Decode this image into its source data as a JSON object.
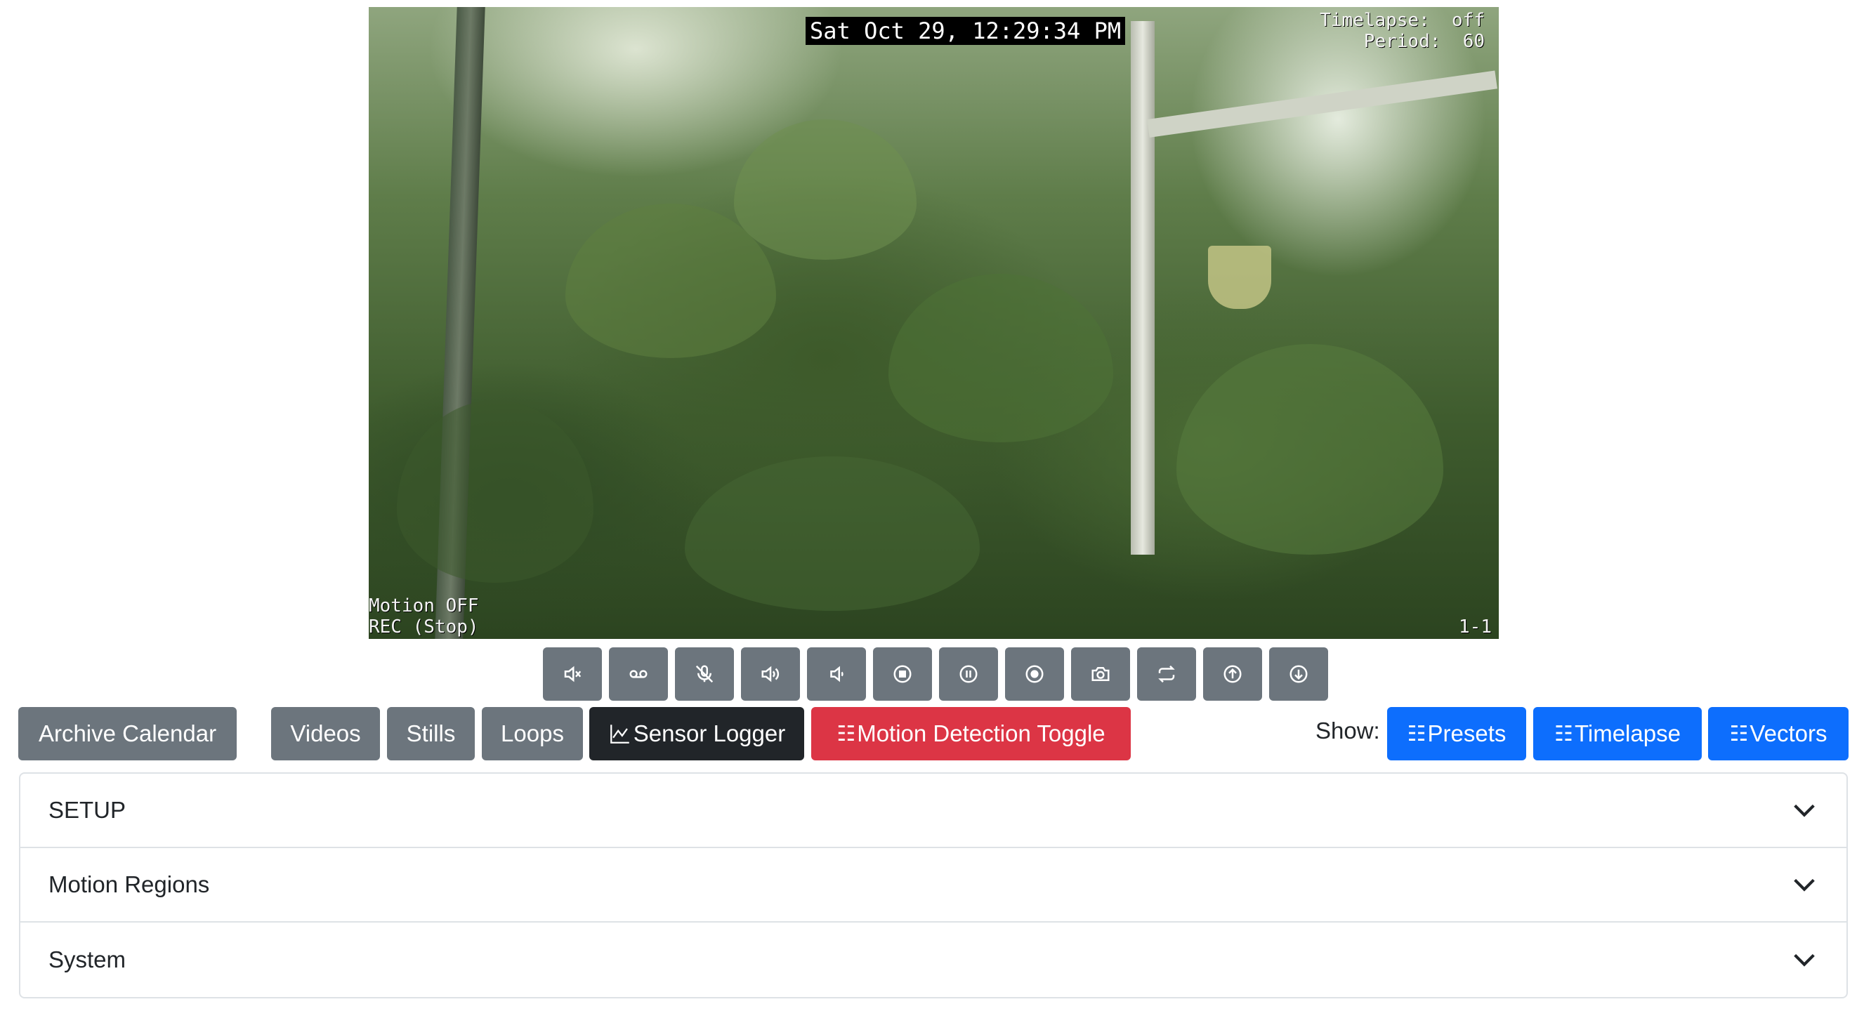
{
  "camera": {
    "timestamp": "Sat Oct 29, 12:29:34 PM",
    "timelapse_label": "Timelapse:",
    "timelapse_value": "off",
    "period_label": "Period:",
    "period_value": "60",
    "motion_status": "Motion OFF",
    "rec_status": "REC (Stop)",
    "camera_id": "1-1"
  },
  "media_controls": [
    {
      "icon": "mute-icon"
    },
    {
      "icon": "voicemail-icon"
    },
    {
      "icon": "mic-off-icon"
    },
    {
      "icon": "volume-up-icon"
    },
    {
      "icon": "volume-down-icon"
    },
    {
      "icon": "stop-circle-icon"
    },
    {
      "icon": "pause-circle-icon"
    },
    {
      "icon": "record-circle-icon"
    },
    {
      "icon": "camera-icon"
    },
    {
      "icon": "repeat-icon"
    },
    {
      "icon": "arrow-up-circle-icon"
    },
    {
      "icon": "arrow-down-circle-icon"
    }
  ],
  "toolbar": {
    "archive_calendar": "Archive Calendar",
    "videos": "Videos",
    "stills": "Stills",
    "loops": "Loops",
    "sensor_logger": "Sensor Logger",
    "motion_toggle": "Motion Detection Toggle",
    "show_label": "Show:",
    "presets": "Presets",
    "timelapse": "Timelapse",
    "vectors": "Vectors"
  },
  "colors": {
    "secondary": "#6c757d",
    "dark": "#212529",
    "danger": "#dc3545",
    "primary": "#0d6efd"
  },
  "accordion": {
    "setup": "SETUP",
    "motion_regions": "Motion Regions",
    "system": "System"
  }
}
